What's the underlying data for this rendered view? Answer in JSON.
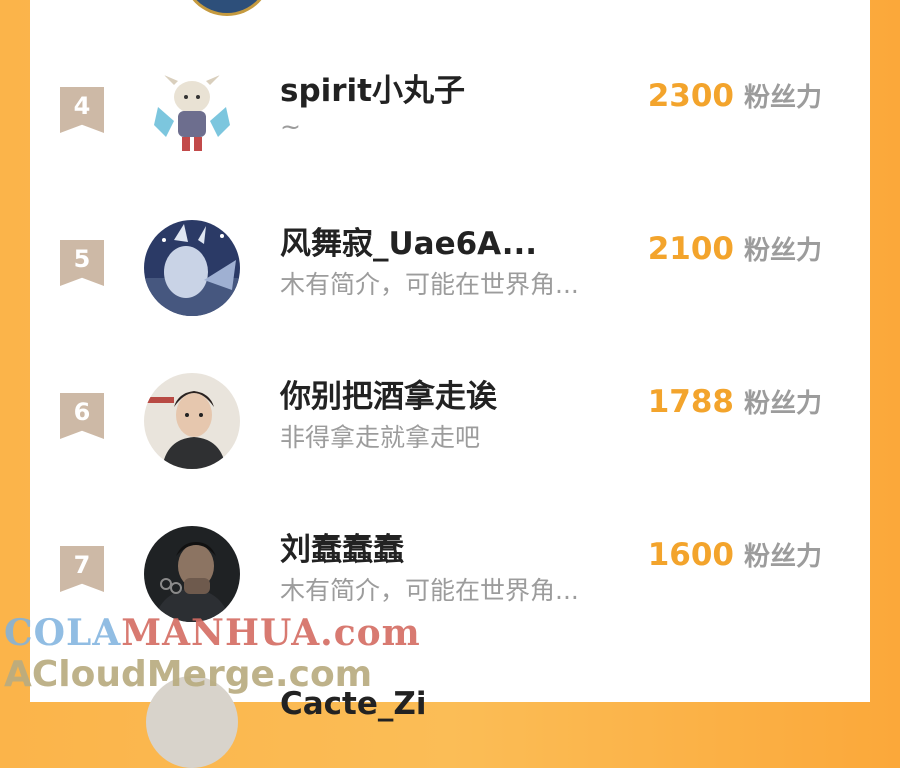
{
  "leaderboard": {
    "rows": [
      {
        "rank": "4",
        "name": "spirit小丸子",
        "bio": "~",
        "fans": "2300",
        "unit": "粉丝力"
      },
      {
        "rank": "5",
        "name": "风舞寂_Uae6A...",
        "bio": "木有简介，可能在世界角...",
        "fans": "2100",
        "unit": "粉丝力"
      },
      {
        "rank": "6",
        "name": "你别把酒拿走诶",
        "bio": "非得拿走就拿走吧",
        "fans": "1788",
        "unit": "粉丝力"
      },
      {
        "rank": "7",
        "name": "刘蠢蠢蠢",
        "bio": "木有简介，可能在世界角...",
        "fans": "1600",
        "unit": "粉丝力"
      }
    ],
    "next_partial_name": "Cacte_Zi"
  },
  "watermark": {
    "line1_a": "COLA",
    "line1_b": "MANHUA.com",
    "line2": "ACloudMerge.com"
  },
  "colors": {
    "background_orange": "#fbb44a",
    "fans_number": "#f3a42c",
    "rank_badge": "#cdb9a6"
  }
}
